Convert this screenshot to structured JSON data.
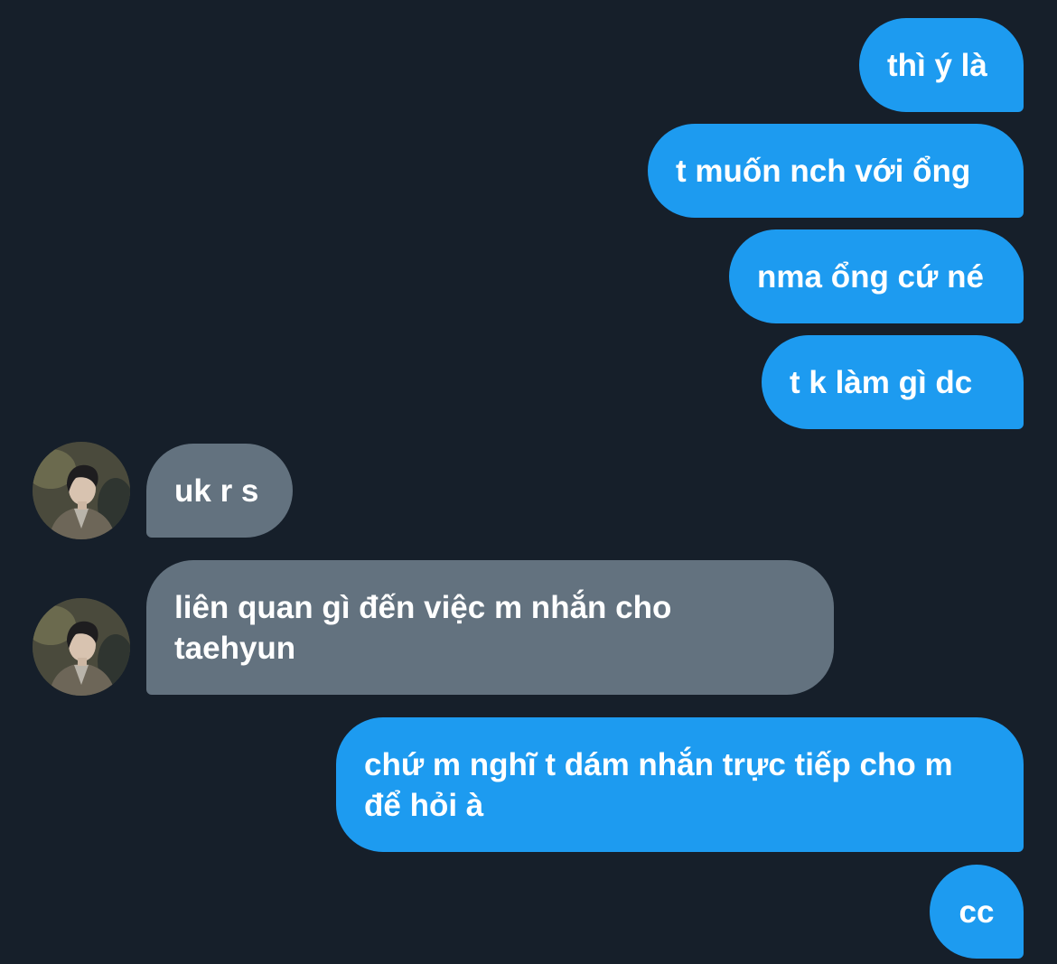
{
  "messages": [
    {
      "direction": "outgoing",
      "text": "thì ý là"
    },
    {
      "direction": "outgoing",
      "text": "t muốn nch với ổng"
    },
    {
      "direction": "outgoing",
      "text": "nma ổng cứ né"
    },
    {
      "direction": "outgoing",
      "text": "t k làm gì dc"
    },
    {
      "direction": "incoming",
      "text": "uk r s",
      "avatar_icon": "contact-avatar"
    },
    {
      "direction": "incoming",
      "text": "liên quan gì đến việc m nhắn cho taehyun",
      "avatar_icon": "contact-avatar"
    },
    {
      "direction": "outgoing",
      "text": "chứ m nghĩ t dám nhắn trực tiếp cho m để hỏi à"
    },
    {
      "direction": "outgoing",
      "text": "cc"
    }
  ],
  "colors": {
    "background": "#161f2a",
    "outgoing_bubble": "#1d9bf0",
    "incoming_bubble": "#63727f",
    "text": "#ffffff"
  }
}
